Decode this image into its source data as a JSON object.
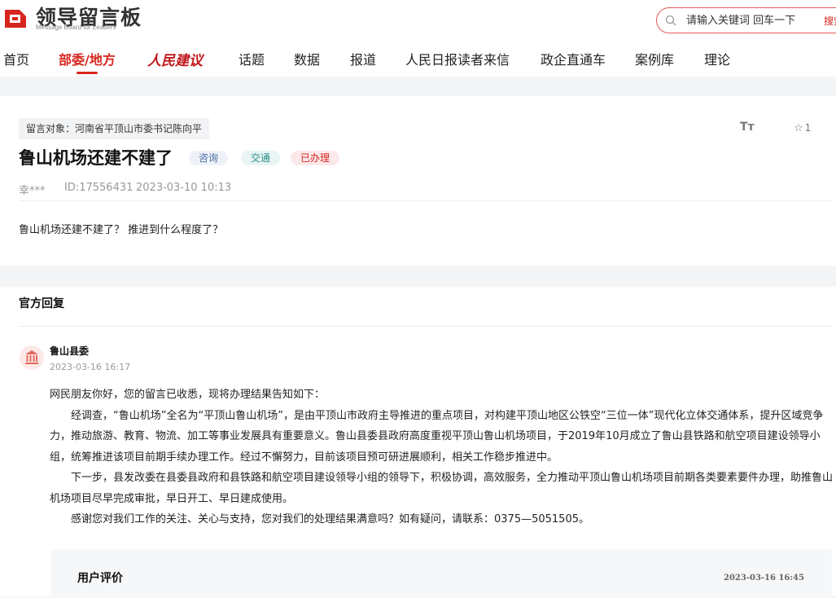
{
  "header": {
    "logo_title": "领导留言板",
    "logo_sub": "Message Board for Leaders",
    "search_placeholder": "请输入关键词 回车一下",
    "search_button": "搜索"
  },
  "nav": {
    "items": [
      "首页",
      "部委/地方",
      "人民建议",
      "话题",
      "数据",
      "报道",
      "人民日报读者来信",
      "政企直通车",
      "案例库",
      "理论"
    ],
    "active_index": 1
  },
  "message": {
    "target": "留言对象：河南省平顶山市委书记陈向平",
    "font_size_label": "Tт",
    "favorite_count": "1",
    "title": "鲁山机场还建不建了",
    "badges": [
      "咨询",
      "交通",
      "已办理"
    ],
    "author": "幸***",
    "id": "ID:17556431",
    "time": "2023-03-10 10:13",
    "body": "鲁山机场还建不建了？  推进到什么程度了？"
  },
  "reply": {
    "section_title": "官方回复",
    "responder": "鲁山县委",
    "time": "2023-03-16 16:17",
    "paragraphs": [
      "网民朋友你好，您的留言已收悉，现将办理结果告知如下：",
      "经调查，“鲁山机场”全名为“平顶山鲁山机场”，是由平顶山市政府主导推进的重点项目，对构建平顶山地区公铁空“三位一体”现代化立体交通体系，提升区域竞争力，推动旅游、教育、物流、加工等事业发展具有重要意义。鲁山县委县政府高度重视平顶山鲁山机场项目，于2019年10月成立了鲁山县铁路和航空项目建设领导小组，统筹推进该项目前期手续办理工作。经过不懈努力，目前该项目预可研进展顺利，相关工作稳步推进中。",
      "下一步，县发改委在县委县政府和县铁路和航空项目建设领导小组的领导下，积极协调，高效服务，全力推动平顶山鲁山机场项目前期各类要素要件办理，助推鲁山机场项目尽早完成审批，早日开工、早日建成使用。",
      "感谢您对我们工作的关注、关心与支持，您对我们的处理结果满意吗？如有疑问，请联系：0375—5051505。"
    ]
  },
  "evaluation": {
    "title": "用户评价",
    "time": "2023-03-16 16:45"
  },
  "colors": {
    "brand_red": "#d7261f",
    "page_bg": "#f4f5f7"
  }
}
